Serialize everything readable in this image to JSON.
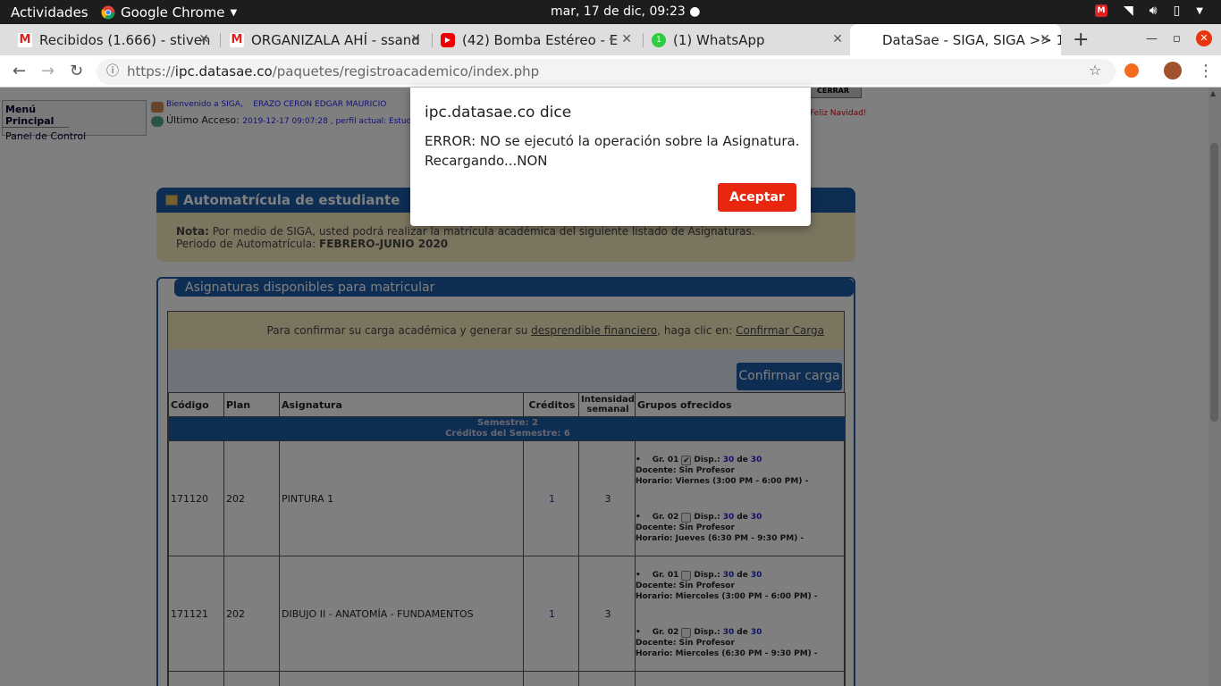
{
  "system_bar": {
    "activities": "Actividades",
    "app_name": "Google Chrome",
    "clock": "mar, 17 de dic, 09:23"
  },
  "tabs": [
    {
      "title": "Recibidos (1.666) - stiven",
      "favicon": "gmail-icon"
    },
    {
      "title": "ORGANIZALA AHÍ - ssand",
      "favicon": "gmail-icon"
    },
    {
      "title": "(42) Bomba Estéreo - E",
      "favicon": "youtube-icon"
    },
    {
      "title": "(1) WhatsApp",
      "favicon": "whatsapp-icon"
    },
    {
      "title": "DataSae - SIGA, SIGA >> 1",
      "favicon": "none"
    }
  ],
  "address_bar": {
    "scheme": "https://",
    "host": "ipc.datasae.co",
    "path": "/paquetes/registroacademico/index.php"
  },
  "sidebar_menu": {
    "heading": "Menú Principal",
    "item": "Panel de Control"
  },
  "header": {
    "welcome": "Bienvenido a SIGA,",
    "user": "ERAZO CERON EDGAR MAURICIO",
    "last_access_label": "Último Acceso:",
    "last_access_value": "2019-12-17 09:07:28 , perfil actual: Estudiante (es",
    "greeting": "Feliz Navidad!",
    "logout": "CERRAR"
  },
  "enrollment_panel": {
    "title": "Automatrícula de estudiante",
    "note_label": "Nota:",
    "note_text": "Por medio de SIGA, usted podrá realizar la matrícula académica del siguiente listado de Asignaturas.",
    "period_label": "Periodo de Automatrícula:",
    "period_value": "FEBRERO-JUNIO 2020"
  },
  "subjects_panel": {
    "title": "Asignaturas disponibles para matricular",
    "confirm_text_1": "Para confirmar su carga académica y generar su",
    "confirm_link_1": "desprendible financiero",
    "confirm_text_2": ", haga clic en:",
    "confirm_link_2": "Confirmar Carga",
    "confirm_button": "Confirmar carga",
    "columns": [
      "Código",
      "Plan",
      "Asignatura",
      "Créditos",
      "Intensidad semanal",
      "Grupos ofrecidos"
    ],
    "semester_line_1": "Semestre: 2",
    "semester_line_2": "Créditos del Semestre: 6",
    "rows": [
      {
        "code": "171120",
        "plan": "202",
        "subject": "PINTURA 1",
        "credits": "1",
        "intensity": "3",
        "groups": [
          {
            "label": "Gr. 01",
            "checked": true,
            "disp": "Disp.:",
            "avail": "30",
            "de": "de",
            "total": "30",
            "teacher": "Docente: Sin Profesor",
            "schedule": "Horario: Viernes (3:00 PM - 6:00 PM) -"
          },
          {
            "label": "Gr. 02",
            "checked": false,
            "disp": "Disp.:",
            "avail": "30",
            "de": "de",
            "total": "30",
            "teacher": "Docente: Sin Profesor",
            "schedule": "Horario: Jueves (6:30 PM - 9:30 PM) -"
          }
        ]
      },
      {
        "code": "171121",
        "plan": "202",
        "subject": "DIBUJO II - ANATOMÍA - FUNDAMENTOS",
        "credits": "1",
        "intensity": "3",
        "groups": [
          {
            "label": "Gr. 01",
            "checked": false,
            "disp": "Disp.:",
            "avail": "30",
            "de": "de",
            "total": "30",
            "teacher": "Docente: Sin Profesor",
            "schedule": "Horario: Miercoles (3:00 PM - 6:00 PM) -"
          },
          {
            "label": "Gr. 02",
            "checked": false,
            "disp": "Disp.:",
            "avail": "30",
            "de": "de",
            "total": "30",
            "teacher": "Docente: Sin Profesor",
            "schedule": "Horario: Miercoles (6:30 PM - 9:30 PM) -"
          }
        ]
      }
    ]
  },
  "dialog": {
    "title": "ipc.datasae.co dice",
    "message": "ERROR: NO se ejecutó la operación sobre la Asignatura. Recargando...NON",
    "ok_button": "Aceptar"
  }
}
